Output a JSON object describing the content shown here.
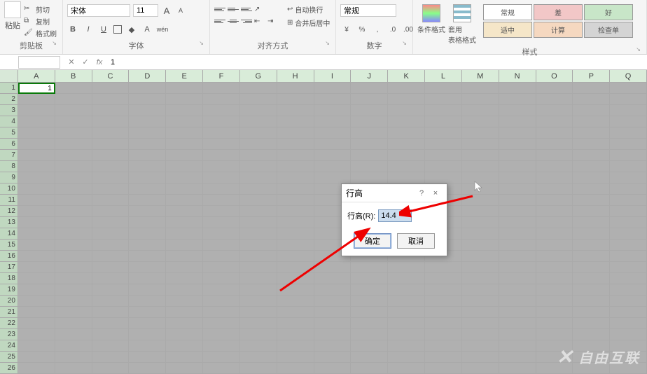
{
  "ribbon": {
    "clipboard": {
      "paste": "粘贴",
      "cut": "剪切",
      "copy": "复制",
      "format_painter": "格式刷",
      "group_label": "剪贴板"
    },
    "font": {
      "name": "宋体",
      "size": "11",
      "group_label": "字体"
    },
    "alignment": {
      "wrap": "自动换行",
      "merge": "合并后居中",
      "group_label": "对齐方式"
    },
    "number": {
      "format": "常规",
      "group_label": "数字"
    },
    "styles": {
      "conditional": "条件格式",
      "table_format": "套用\n表格格式",
      "normal": "常规",
      "bad": "差",
      "good": "好",
      "moderate": "适中",
      "calculation": "计算",
      "check_cell": "检查单",
      "group_label": "样式"
    }
  },
  "formula_bar": {
    "name_box": "",
    "fx": "fx",
    "value": "1"
  },
  "columns": [
    "A",
    "B",
    "C",
    "D",
    "E",
    "F",
    "G",
    "H",
    "I",
    "J",
    "K",
    "L",
    "M",
    "N",
    "O",
    "P",
    "Q"
  ],
  "rows_count": 26,
  "cell_a1": "1",
  "dialog": {
    "title": "行高",
    "label": "行高(R):",
    "value": "14.4",
    "ok": "确定",
    "cancel": "取消",
    "help": "?",
    "close": "×"
  },
  "watermark": "自由互联"
}
